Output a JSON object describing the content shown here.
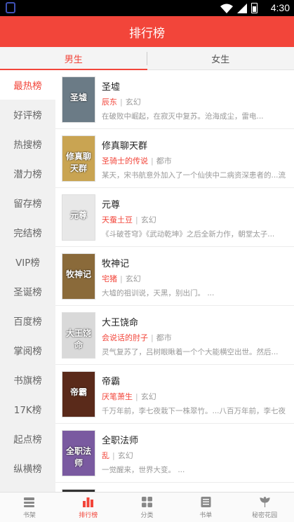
{
  "status_bar": {
    "time": "4:30"
  },
  "header": {
    "title": "排行榜"
  },
  "tabs": [
    {
      "label": "男生",
      "active": true
    },
    {
      "label": "女生",
      "active": false
    }
  ],
  "sidebar": {
    "items": [
      {
        "label": "最热榜",
        "active": true
      },
      {
        "label": "好评榜"
      },
      {
        "label": "热搜榜"
      },
      {
        "label": "潜力榜"
      },
      {
        "label": "留存榜"
      },
      {
        "label": "完结榜"
      },
      {
        "label": "VIP榜"
      },
      {
        "label": "圣诞榜"
      },
      {
        "label": "百度榜"
      },
      {
        "label": "掌阅榜"
      },
      {
        "label": "书旗榜"
      },
      {
        "label": "17K榜"
      },
      {
        "label": "起点榜"
      },
      {
        "label": "纵横榜"
      }
    ]
  },
  "books": [
    {
      "title": "圣墟",
      "author": "辰东",
      "genre": "玄幻",
      "desc": "在破败中崛起，在寂灭中复苏。沧海成尘，雷电...",
      "cover_text": "圣墟",
      "cover_color": "#6b7b86"
    },
    {
      "title": "修真聊天群",
      "author": "圣骑士的传说",
      "genre": "都市",
      "desc": "某天，宋书航意外加入了一个仙侠中二病资深患者的...流",
      "cover_text": "修真聊天群",
      "cover_color": "#c9a452"
    },
    {
      "title": "元尊",
      "author": "天蚕土豆",
      "genre": "玄幻",
      "desc": "《斗破苍穹》《武动乾坤》之后全新力作，朝堂太子...",
      "cover_text": "元尊",
      "cover_color": "#e8e8e8"
    },
    {
      "title": "牧神记",
      "author": "宅猪",
      "genre": "玄幻",
      "desc": "大墟的祖训说，天黑，别出门。 ...",
      "cover_text": "牧神记",
      "cover_color": "#8a6a3a"
    },
    {
      "title": "大王饶命",
      "author": "会说话的肘子",
      "genre": "都市",
      "desc": "灵气复苏了，吕树眼瞅着一个个大能横空出世。然后...",
      "cover_text": "大王饶命",
      "cover_color": "#d9d9d9"
    },
    {
      "title": "帝霸",
      "author": "厌笔萧生",
      "genre": "玄幻",
      "desc": "千万年前，李七夜栽下一株翠竹。...八百万年前，李七夜",
      "cover_text": "帝霸",
      "cover_color": "#5a2a1a"
    },
    {
      "title": "全职法师",
      "author": "乱",
      "genre": "玄幻",
      "desc": "一觉醒来，世界大变。 ...",
      "cover_text": "全职法师",
      "cover_color": "#7a5aa0"
    },
    {
      "title": "",
      "author": "",
      "genre": "",
      "desc": "",
      "cover_text": "",
      "cover_color": "#333333"
    }
  ],
  "bottom_nav": [
    {
      "label": "书架",
      "icon": "bookshelf-icon"
    },
    {
      "label": "排行榜",
      "icon": "ranking-icon",
      "active": true
    },
    {
      "label": "分类",
      "icon": "category-icon"
    },
    {
      "label": "书单",
      "icon": "booklist-icon"
    },
    {
      "label": "秘密花园",
      "icon": "garden-icon"
    }
  ],
  "colors": {
    "accent": "#f2453a"
  }
}
